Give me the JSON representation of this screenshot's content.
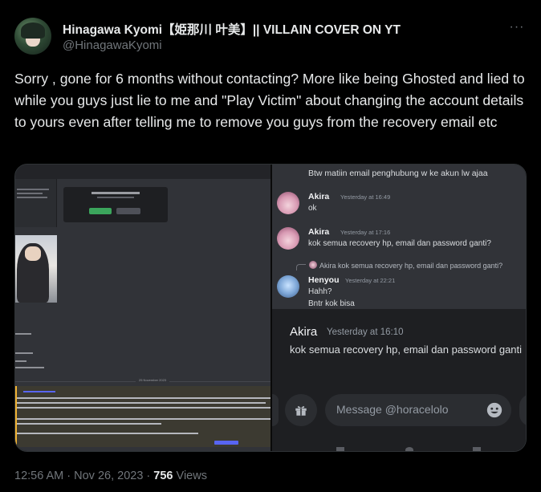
{
  "author": {
    "display_name": "Hinagawa Kyomi【姫那川 叶美】|| VILLAIN COVER ON YT",
    "handle": "@HinagawaKyomi",
    "more_icon": "ellipsis-icon"
  },
  "tweet": {
    "text": "Sorry , gone for 6 months without contacting? More like being Ghosted and lied to while you guys just lie to me and \"Play Victim\" about changing the account details to yours even after telling me to remove you guys from the recovery email etc",
    "time": "12:56 AM · Nov 26, 2023 · ",
    "views_count": "756",
    "views_label": " Views"
  },
  "media": {
    "left_panel": {
      "date_divider": "25 November 2023"
    },
    "right_top": {
      "first_line": "Btw matiin email penghubung w ke akun lw ajaa",
      "messages": [
        {
          "name": "Akira",
          "time": "Yesterday at 16:49",
          "text": "ok"
        },
        {
          "name": "Akira",
          "time": "Yesterday at 17:16",
          "text": "kok semua recovery hp, email dan password ganti?"
        },
        {
          "name": "Henyou",
          "time": "Yesterday at 22:21",
          "text": "Hahh?",
          "text2": "Bntr kok bisa"
        }
      ],
      "reply_preview": "Akira kok semua recovery hp, email dan password ganti?"
    },
    "right_bottom": {
      "name": "Akira",
      "time": "Yesterday at 16:10",
      "text": "kok semua recovery hp, email dan password ganti",
      "input_placeholder": "Message @horacelolo",
      "gift_icon": "gift-icon",
      "emoji_icon": "emoji-icon"
    }
  },
  "colors": {
    "background": "#000000",
    "text": "#e7e9ea",
    "muted": "#71767b",
    "discord_bg": "#313338",
    "discord_dark": "#1e1f22"
  }
}
